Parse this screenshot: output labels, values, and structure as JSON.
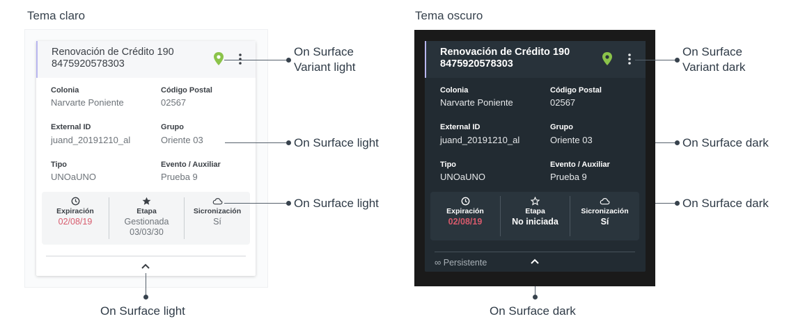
{
  "light_section": {
    "title": "Tema claro"
  },
  "dark_section": {
    "title": "Tema oscuro"
  },
  "card": {
    "title_line1": "Renovación de Crédito 190",
    "title_line2": "8475920578303",
    "fields": {
      "colonia_label": "Colonia",
      "colonia_value": "Narvarte Poniente",
      "cp_label": "Código Postal",
      "cp_value": "02567",
      "external_label": "External ID",
      "external_value": "juand_20191210_al",
      "grupo_label": "Grupo",
      "grupo_value": "Oriente 03",
      "tipo_label": "Tipo",
      "tipo_value": "UNOaUNO",
      "evento_label": "Evento / Auxiliar",
      "evento_value": "Prueba 9"
    },
    "expiracion_label": "Expiración",
    "expiracion_value": "02/08/19",
    "etapa_label": "Etapa",
    "sync_label": "Sicronización",
    "sync_value": "Sí"
  },
  "light_card": {
    "etapa_value_line1": "Gestionada",
    "etapa_value_line2": "03/03/30"
  },
  "dark_card": {
    "etapa_value": "No iniciada",
    "persistent_label": "Persistente",
    "persistent_icon": "infinity-icon"
  },
  "annotations": {
    "light_variant_line1": "On Surface",
    "light_variant_line2": "Variant light",
    "light_surface_1": "On Surface light",
    "light_surface_2": "On Surface light",
    "light_surface_bottom": "On Surface light",
    "dark_variant_line1": "On Surface",
    "dark_variant_line2": "Variant dark",
    "dark_surface_1": "On Surface dark",
    "dark_surface_2": "On Surface dark",
    "dark_surface_bottom": "On Surface dark"
  },
  "colors": {
    "accent_border": "#b8b6ef",
    "pin_green": "#8bc34a",
    "expiration_red": "#d75a6c",
    "dark_card_bg": "#222b32",
    "dark_frame_bg": "#1a1a1a"
  }
}
